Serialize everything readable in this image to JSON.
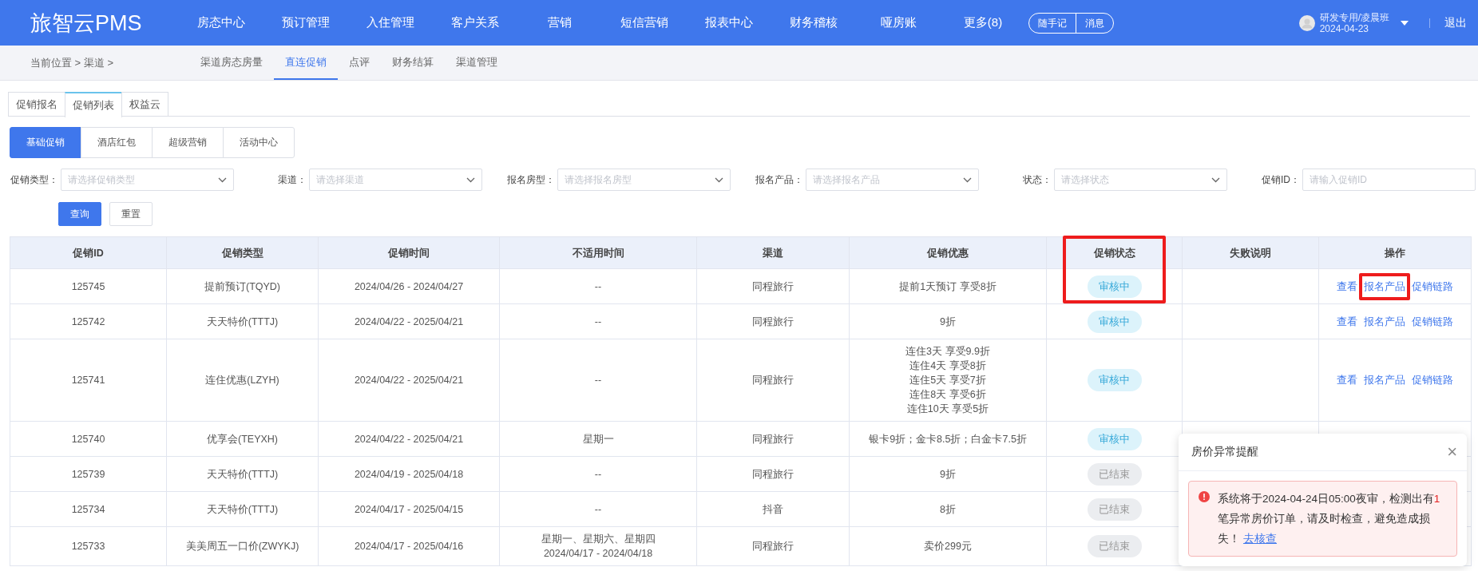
{
  "top_nav": {
    "logo": "旅智云PMS",
    "items": [
      "房态中心",
      "预订管理",
      "入住管理",
      "客户关系",
      "营销",
      "短信营销",
      "报表中心",
      "财务稽核",
      "哑房账",
      "更多(8)"
    ],
    "pill_buttons": [
      "随手记",
      "消息"
    ],
    "user": {
      "name": "研发专用/凌晨班",
      "date": "2024-04-23"
    },
    "logout": "退出"
  },
  "breadcrumb": "当前位置 > 渠道 >",
  "channel_tabs": [
    {
      "label": "渠道房态房量",
      "selected": false
    },
    {
      "label": "直连促销",
      "selected": true
    },
    {
      "label": "点评",
      "selected": false
    },
    {
      "label": "财务结算",
      "selected": false
    },
    {
      "label": "渠道管理",
      "selected": false
    }
  ],
  "page_tabs": [
    {
      "label": "促销报名",
      "selected": false
    },
    {
      "label": "促销列表",
      "selected": true
    },
    {
      "label": "权益云",
      "selected": false
    }
  ],
  "segments": [
    {
      "label": "基础促销",
      "selected": true
    },
    {
      "label": "酒店红包",
      "selected": false
    },
    {
      "label": "超级营销",
      "selected": false
    },
    {
      "label": "活动中心",
      "selected": false
    }
  ],
  "filters": [
    {
      "label": "促销类型：",
      "placeholder": "请选择促销类型",
      "kind": "select"
    },
    {
      "label": "渠道：",
      "placeholder": "请选择渠道",
      "kind": "select"
    },
    {
      "label": "报名房型：",
      "placeholder": "请选择报名房型",
      "kind": "select"
    },
    {
      "label": "报名产品：",
      "placeholder": "请选择报名产品",
      "kind": "select"
    },
    {
      "label": "状态：",
      "placeholder": "请选择状态",
      "kind": "select"
    },
    {
      "label": "促销ID：",
      "placeholder": "请输入促销ID",
      "kind": "input"
    }
  ],
  "buttons": [
    {
      "label": "查询",
      "kind": "primary"
    },
    {
      "label": "重置",
      "kind": "default"
    }
  ],
  "table": {
    "columns": [
      {
        "label": "促销ID",
        "highlighted": false
      },
      {
        "label": "促销类型",
        "highlighted": false
      },
      {
        "label": "促销时间",
        "highlighted": false
      },
      {
        "label": "不适用时间",
        "highlighted": false
      },
      {
        "label": "渠道",
        "highlighted": false
      },
      {
        "label": "促销优惠",
        "highlighted": false
      },
      {
        "label": "促销状态",
        "highlighted": true
      },
      {
        "label": "失败说明",
        "highlighted": false
      },
      {
        "label": "操作",
        "highlighted": false
      }
    ],
    "rows": [
      {
        "id": "125745",
        "type": "提前预订(TQYD)",
        "time": "2024/04/26 - 2024/04/27",
        "excluded_time": [
          "--"
        ],
        "channel": "同程旅行",
        "discount": [
          "提前1天预订 享受8折"
        ],
        "status": {
          "label": "审核中",
          "kind": "reviewing"
        },
        "actions": [
          {
            "label": "查看",
            "highlighted": false
          },
          {
            "label": "报名产品",
            "highlighted": true
          },
          {
            "label": "促销链路",
            "highlighted": false
          }
        ]
      },
      {
        "id": "125742",
        "type": "天天特价(TTTJ)",
        "time": "2024/04/22 - 2025/04/21",
        "excluded_time": [
          "--"
        ],
        "channel": "同程旅行",
        "discount": [
          "9折"
        ],
        "status": {
          "label": "审核中",
          "kind": "reviewing"
        },
        "actions": [
          {
            "label": "查看",
            "highlighted": false
          },
          {
            "label": "报名产品",
            "highlighted": false
          },
          {
            "label": "促销链路",
            "highlighted": false
          }
        ]
      },
      {
        "id": "125741",
        "type": "连住优惠(LZYH)",
        "time": "2024/04/22 - 2025/04/21",
        "excluded_time": [
          "--"
        ],
        "channel": "同程旅行",
        "discount": [
          "连住3天 享受9.9折",
          "连住4天 享受8折",
          "连住5天 享受7折",
          "连住8天 享受6折",
          "连住10天 享受5折"
        ],
        "status": {
          "label": "审核中",
          "kind": "reviewing"
        },
        "actions": [
          {
            "label": "查看",
            "highlighted": false
          },
          {
            "label": "报名产品",
            "highlighted": false
          },
          {
            "label": "促销链路",
            "highlighted": false
          }
        ]
      },
      {
        "id": "125740",
        "type": "优享会(TEYXH)",
        "time": "2024/04/22 - 2025/04/21",
        "excluded_time": [
          "星期一"
        ],
        "channel": "同程旅行",
        "discount": [
          "银卡9折；金卡8.5折；白金卡7.5折"
        ],
        "status": {
          "label": "审核中",
          "kind": "reviewing"
        },
        "actions": []
      },
      {
        "id": "125739",
        "type": "天天特价(TTTJ)",
        "time": "2024/04/19 - 2025/04/18",
        "excluded_time": [
          "--"
        ],
        "channel": "同程旅行",
        "discount": [
          "9折"
        ],
        "status": {
          "label": "已结束",
          "kind": "ended"
        },
        "actions": []
      },
      {
        "id": "125734",
        "type": "天天特价(TTTJ)",
        "time": "2024/04/17 - 2025/04/15",
        "excluded_time": [
          "--"
        ],
        "channel": "抖音",
        "discount": [
          "8折"
        ],
        "status": {
          "label": "已结束",
          "kind": "ended"
        },
        "actions": []
      },
      {
        "id": "125733",
        "type": "美美周五一口价(ZWYKJ)",
        "time": "2024/04/17 - 2025/04/16",
        "excluded_time": [
          "星期一、星期六、星期四",
          "2024/04/17 - 2024/04/18"
        ],
        "channel": "同程旅行",
        "discount": [
          "卖价299元"
        ],
        "status": {
          "label": "已结束",
          "kind": "ended"
        },
        "actions": []
      }
    ]
  },
  "alert_popup": {
    "title": "房价异常提醒",
    "close": "×",
    "message_parts": [
      {
        "text": "系统将于2024-04-24日05:00夜审，检测出有",
        "kind": "plain"
      },
      {
        "text": "1",
        "kind": "count"
      },
      {
        "text": "笔异常房价订单，请及时检查，避免造成损失！",
        "kind": "plain"
      }
    ],
    "link": "去核查"
  }
}
